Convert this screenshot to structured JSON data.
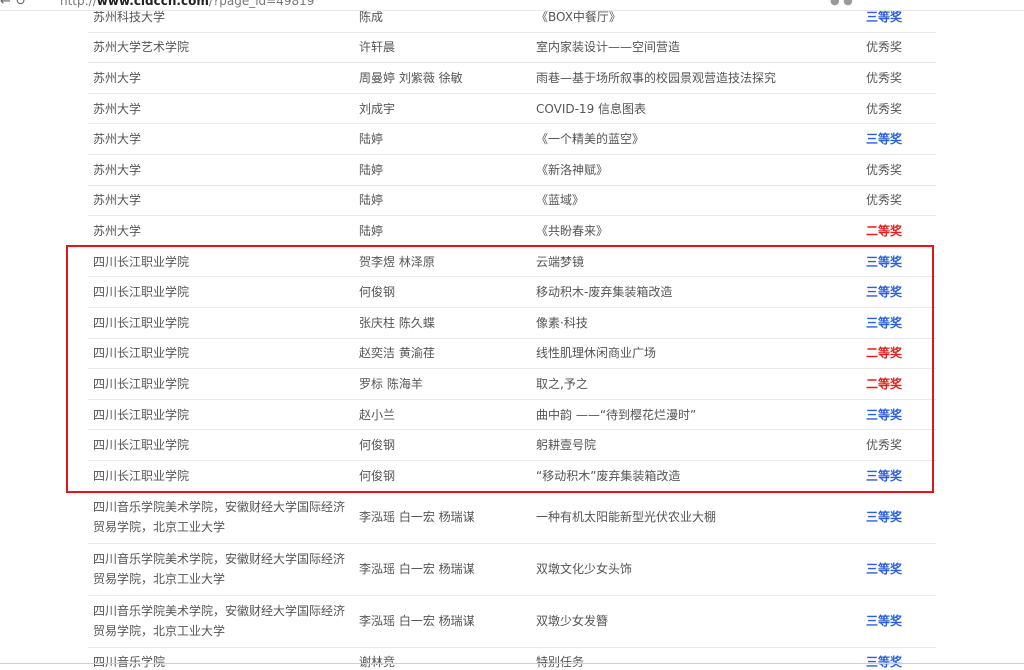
{
  "browser": {
    "url_prefix": "http://",
    "url_domain": "www.cidcch.com",
    "url_rest": "/?page_id=49819"
  },
  "colors": {
    "third_prize": "#2b5fd9",
    "second_prize": "#e0201a",
    "highlight_border": "#e8141a"
  },
  "rows": [
    {
      "school": "苏州科技大学",
      "author": "陈成",
      "work": "《BOX中餐厅》",
      "award": "三等奖",
      "level": "third"
    },
    {
      "school": "苏州大学艺术学院",
      "author": "许轩晨",
      "work": "室内家装设计——空间营造",
      "award": "优秀奖",
      "level": "excellent"
    },
    {
      "school": "苏州大学",
      "author": "周曼婷 刘紫薇 徐敏",
      "work": "雨巷—基于场所叙事的校园景观营造技法探究",
      "award": "优秀奖",
      "level": "excellent"
    },
    {
      "school": "苏州大学",
      "author": "刘成宇",
      "work": "COVID-19 信息图表",
      "award": "优秀奖",
      "level": "excellent"
    },
    {
      "school": "苏州大学",
      "author": "陆婷",
      "work": "《一个精美的蓝空》",
      "award": "三等奖",
      "level": "third"
    },
    {
      "school": "苏州大学",
      "author": "陆婷",
      "work": "《新洛神赋》",
      "award": "优秀奖",
      "level": "excellent"
    },
    {
      "school": "苏州大学",
      "author": "陆婷",
      "work": "《蓝域》",
      "award": "优秀奖",
      "level": "excellent"
    },
    {
      "school": "苏州大学",
      "author": "陆婷",
      "work": "《共盼春来》",
      "award": "二等奖",
      "level": "second"
    },
    {
      "school": "四川长江职业学院",
      "author": "贺李煜 林泽原",
      "work": "云端梦镜",
      "award": "三等奖",
      "level": "third"
    },
    {
      "school": "四川长江职业学院",
      "author": "何俊钢",
      "work": "移动积木-废弃集装箱改造",
      "award": "三等奖",
      "level": "third"
    },
    {
      "school": "四川长江职业学院",
      "author": "张庆柱 陈久蝶",
      "work": "像素·科技",
      "award": "三等奖",
      "level": "third"
    },
    {
      "school": "四川长江职业学院",
      "author": "赵奕洁 黄渝荏",
      "work": "线性肌理休闲商业广场",
      "award": "二等奖",
      "level": "second"
    },
    {
      "school": "四川长江职业学院",
      "author": "罗标 陈海羊",
      "work": "取之,予之",
      "award": "二等奖",
      "level": "second"
    },
    {
      "school": "四川长江职业学院",
      "author": "赵小兰",
      "work": "曲中韵 ——“待到樱花烂漫时”",
      "award": "三等奖",
      "level": "third"
    },
    {
      "school": "四川长江职业学院",
      "author": "何俊钢",
      "work": "躬耕壹号院",
      "award": "优秀奖",
      "level": "excellent"
    },
    {
      "school": "四川长江职业学院",
      "author": "何俊钢",
      "work": "“移动积木”废弃集装箱改造",
      "award": "三等奖",
      "level": "third"
    },
    {
      "school": "四川音乐学院美术学院，安徽财经大学国际经济贸易学院，北京工业大学",
      "author": "李泓瑶 白一宏 杨瑞谋",
      "work": "一种有机太阳能新型光伏农业大棚",
      "award": "三等奖",
      "level": "third"
    },
    {
      "school": "四川音乐学院美术学院，安徽财经大学国际经济贸易学院，北京工业大学",
      "author": "李泓瑶 白一宏 杨瑞谋",
      "work": "双墩文化少女头饰",
      "award": "三等奖",
      "level": "third"
    },
    {
      "school": "四川音乐学院美术学院，安徽财经大学国际经济贸易学院，北京工业大学",
      "author": "李泓瑶 白一宏 杨瑞谋",
      "work": "双墩少女发簪",
      "award": "三等奖",
      "level": "third"
    },
    {
      "school": "四川音乐学院",
      "author": "谢林竞",
      "work": "特别任务",
      "award": "三等奖",
      "level": "third"
    }
  ]
}
